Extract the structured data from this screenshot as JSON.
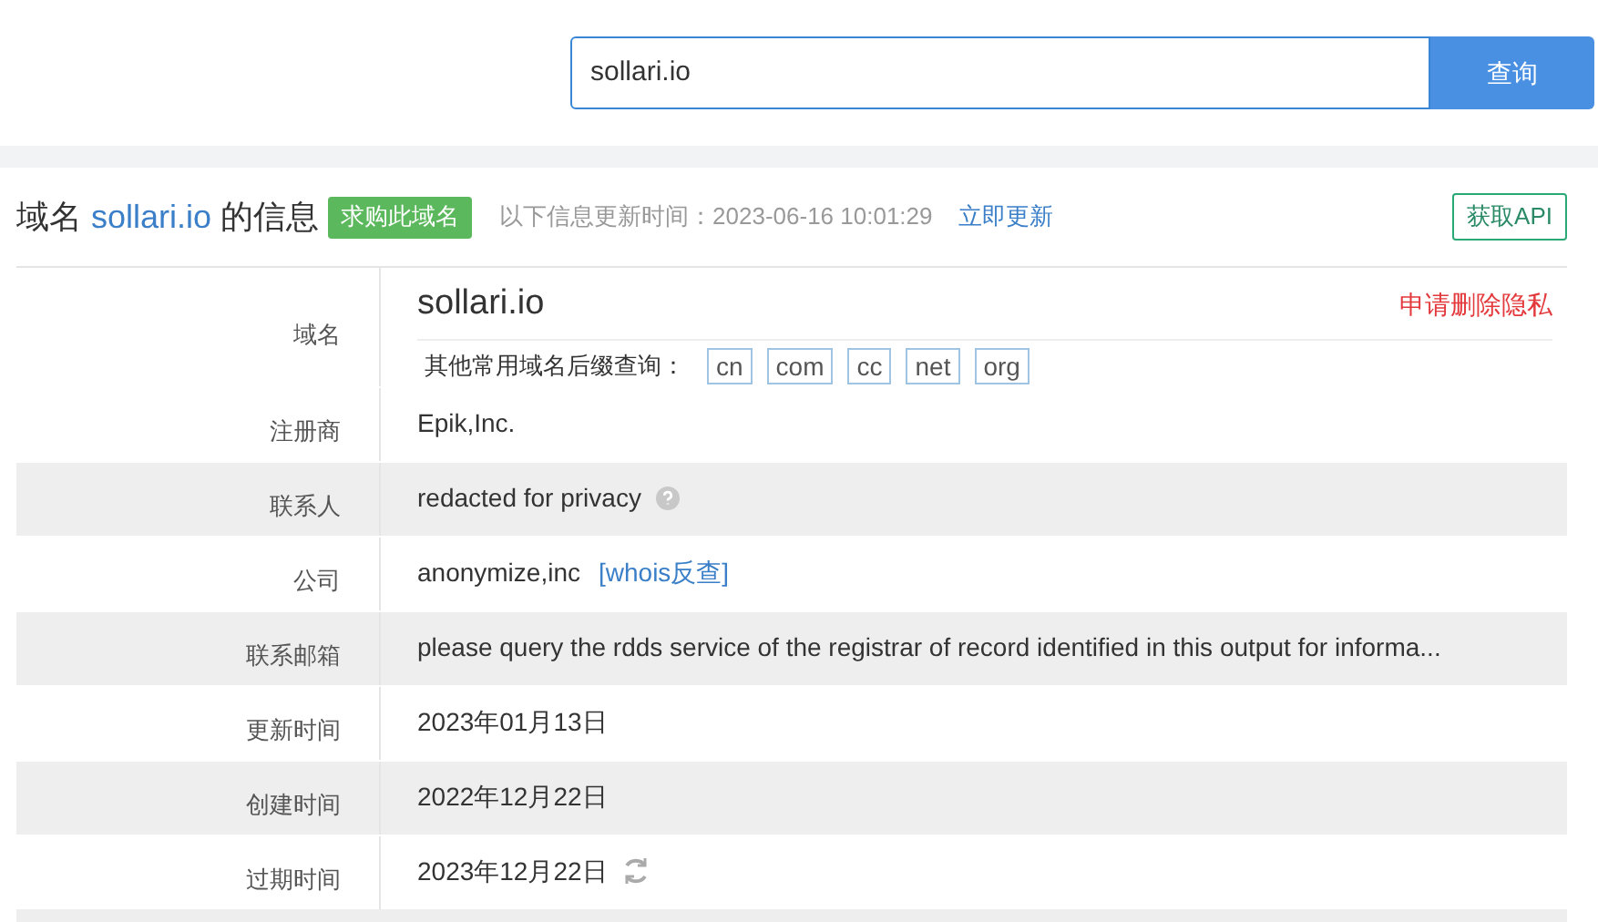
{
  "search": {
    "value": "sollari.io",
    "button": "查询"
  },
  "header": {
    "prefix": "域名",
    "domain": "sollari.io",
    "suffix": "的信息",
    "buy_button": "求购此域名",
    "updated": "以下信息更新时间：2023-06-16 10:01:29",
    "refresh_link": "立即更新",
    "api_button": "获取API"
  },
  "rows": [
    {
      "kind": "domain",
      "label": "域名",
      "value": "sollari.io",
      "privacy_link": "申请删除隐私",
      "suffix_label": "其他常用域名后缀查询：",
      "suffixes": [
        "cn",
        "com",
        "cc",
        "net",
        "org"
      ]
    },
    {
      "kind": "text",
      "label": "注册商",
      "value": "Epik,Inc."
    },
    {
      "kind": "help",
      "label": "联系人",
      "value": "redacted for privacy"
    },
    {
      "kind": "link",
      "label": "公司",
      "value": "anonymize,inc",
      "link": "[whois反查]"
    },
    {
      "kind": "text",
      "label": "联系邮箱",
      "value": "please query the rdds service of the registrar of record identified in this output for informa..."
    },
    {
      "kind": "text",
      "label": "更新时间",
      "value": "2023年01月13日"
    },
    {
      "kind": "text",
      "label": "创建时间",
      "value": "2022年12月22日"
    },
    {
      "kind": "refresh",
      "label": "过期时间",
      "value": "2023年12月22日"
    }
  ]
}
